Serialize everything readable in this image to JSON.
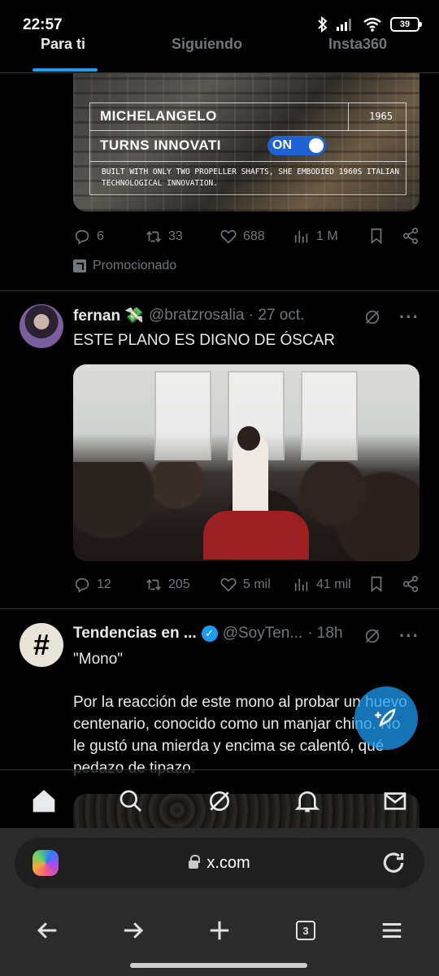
{
  "status_bar": {
    "time": "22:57",
    "battery": "39"
  },
  "tabs": [
    {
      "label": "Para ti",
      "active": true
    },
    {
      "label": "Siguiendo",
      "active": false
    },
    {
      "label": "Insta360",
      "active": false
    }
  ],
  "ad": {
    "title_line1": "MICHELANGELO",
    "year": "1965",
    "title_line2": "TURNS INNOVATI",
    "toggle": "ON",
    "description": "BUILT WITH ONLY TWO PROPELLER SHAFTS, SHE EMBODIED 1960S ITALIAN TECHNOLOGICAL INNOVATION.",
    "actions": {
      "replies": "6",
      "reposts": "33",
      "likes": "688",
      "views": "1 M"
    },
    "promoted_label": "Promocionado"
  },
  "post1": {
    "name": "fernan 💸",
    "handle": "@bratzrosalia · 27 oct.",
    "text": "ESTE PLANO ES DIGNO DE ÓSCAR",
    "actions": {
      "replies": "12",
      "reposts": "205",
      "likes": "5 mil",
      "views": "41 mil"
    }
  },
  "post2": {
    "avatar_symbol": "#",
    "name": "Tendencias en ...",
    "handle": "@SoyTen...",
    "time": "· 18h",
    "text_quote": "\"Mono\"",
    "text_body": "Por la reacción de este mono al probar un huevo centenario, conocido como un manjar chino. No le gustó una mierda y encima se calentó, qué pedazo de tipazo."
  },
  "browser": {
    "url": "x.com",
    "tab_count": "3"
  },
  "colors": {
    "accent": "#1d9bf0",
    "background": "#000000",
    "muted": "#71767b"
  }
}
